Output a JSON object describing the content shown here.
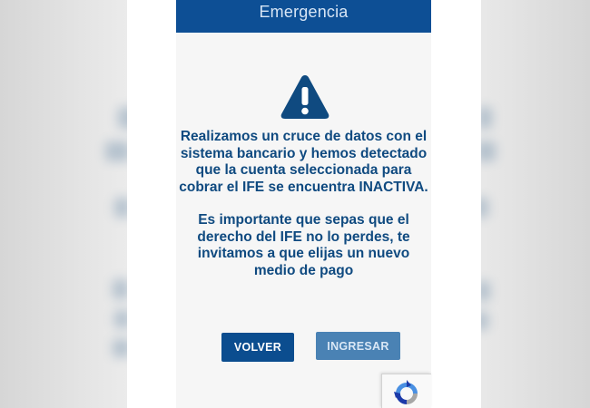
{
  "app": {
    "header_title": "Emergencia"
  },
  "alert": {
    "icon": "warning-triangle-icon",
    "paragraph1": "Realizamos un cruce de datos con el sistema bancario y hemos detectado que la cuenta seleccionada para cobrar el IFE se encuentra INACTIVA.",
    "paragraph2": "Es importante que sepas que el derecho del IFE no lo perdes, te invitamos a que elijas un nuevo medio de pago"
  },
  "actions": {
    "back_label": "VOLVER",
    "enter_label": "INGRESAR"
  },
  "badge": {
    "icon": "recaptcha-icon"
  },
  "colors": {
    "header": "#0d4f95",
    "text": "#0f4a80",
    "primary_button": "#0b4d8f",
    "secondary_button": "#4a82b4"
  }
}
